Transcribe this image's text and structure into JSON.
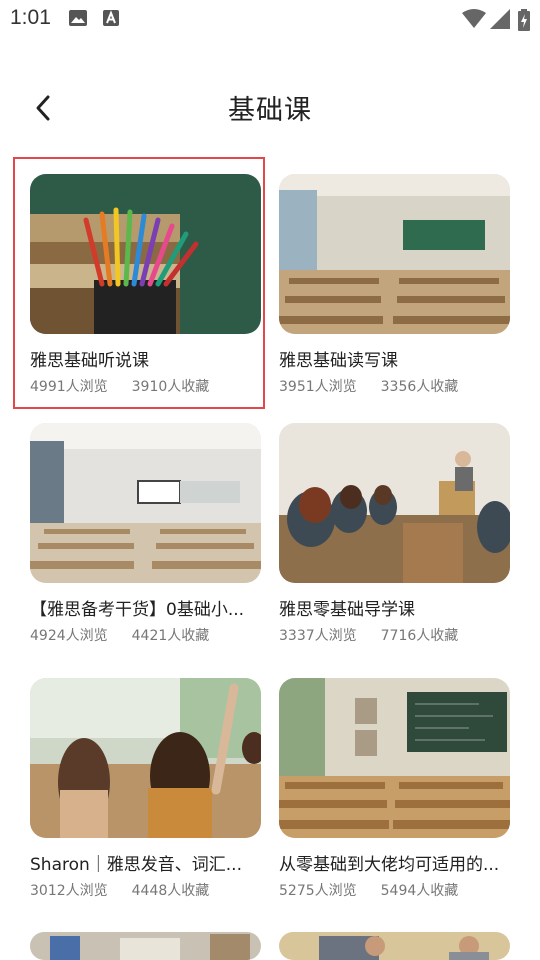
{
  "status_bar": {
    "time": "1:01"
  },
  "header": {
    "title": "基础课"
  },
  "colors": {
    "selection_border": "#e2474b",
    "stat_text": "#777777"
  },
  "courses": [
    {
      "title": "雅思基础听说课",
      "views": "4991人浏览",
      "favorites": "3910人收藏",
      "image": "pencils-and-books"
    },
    {
      "title": "雅思基础读写课",
      "views": "3951人浏览",
      "favorites": "3356人收藏",
      "image": "classroom"
    },
    {
      "title": "【雅思备考干货】0基础小...",
      "views": "4924人浏览",
      "favorites": "4421人收藏",
      "image": "empty-classroom"
    },
    {
      "title": "雅思零基础导学课",
      "views": "3337人浏览",
      "favorites": "7716人收藏",
      "image": "lecture-hall"
    },
    {
      "title": "Sharon｜雅思发音、词汇...",
      "views": "3012人浏览",
      "favorites": "4448人收藏",
      "image": "students-raising-hands"
    },
    {
      "title": "从零基础到大佬均可适用的...",
      "views": "5275人浏览",
      "favorites": "5494人收藏",
      "image": "chalkboard-classroom"
    }
  ]
}
